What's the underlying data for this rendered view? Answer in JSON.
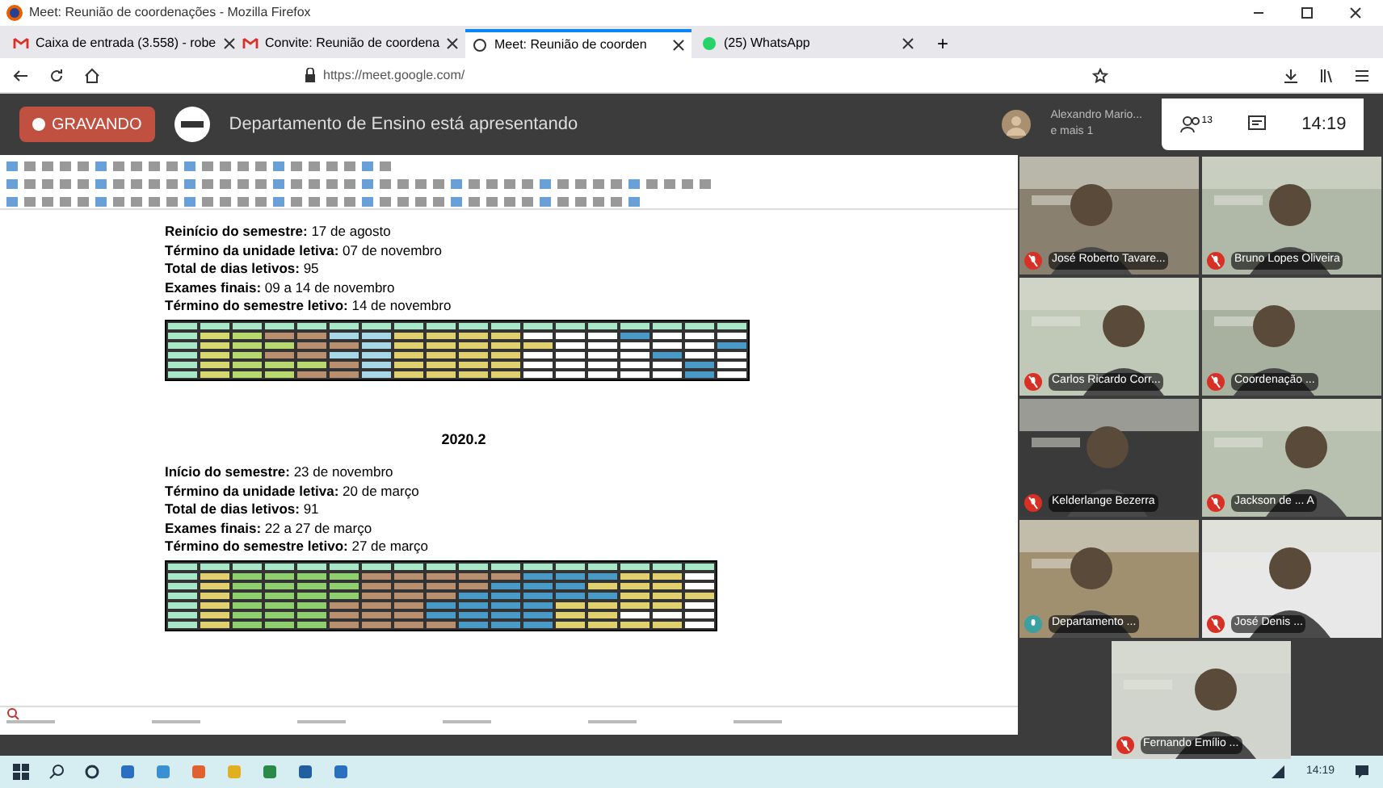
{
  "window": {
    "title": "Meet: Reunião de coordenações - Mozilla Firefox"
  },
  "tabs": [
    {
      "label": "Caixa de entrada (3.558) - robe",
      "kind": "mail",
      "selected": false
    },
    {
      "label": "Convite: Reunião de coordena",
      "kind": "mail",
      "selected": false
    },
    {
      "label": "Meet: Reunião de coorden",
      "kind": "meet",
      "selected": true
    },
    {
      "label": "(25) WhatsApp",
      "kind": "chat",
      "selected": false
    }
  ],
  "new_tab": "+",
  "address_bar": {
    "url": "https://meet.google.com/"
  },
  "meet_bar": {
    "recording": "GRAVANDO",
    "presenter": "Departamento de Ensino está apresentando",
    "viewer": "Alexandro Mario...",
    "viewer_more": "e mais 1",
    "participants_count": "13",
    "clock": "14:19"
  },
  "document": {
    "lines_1": [
      "**Reinício do semestre:** 17 de agosto",
      "**Término da unidade letiva:** 07 de novembro",
      "**Total de dias letivos:** 95",
      "**Exames finais:** 09 a 14 de novembro",
      "**Término do semestre letivo:** 14 de novembro"
    ],
    "table_1": [
      {
        "cells": [
          {
            "color": "#a8e8c8"
          },
          {
            "color": "#a8e8c8"
          },
          {
            "color": "#a8e8c8"
          },
          {
            "color": "#a8e8c8"
          },
          {
            "color": "#a8e8c8"
          },
          {
            "color": "#a8e8c8"
          },
          {
            "color": "#a8e8c8"
          },
          {
            "color": "#a8e8c8"
          },
          {
            "color": "#a8e8c8"
          },
          {
            "color": "#a8e8c8"
          },
          {
            "color": "#a8e8c8"
          },
          {
            "color": "#a8e8c8"
          },
          {
            "color": "#a8e8c8"
          },
          {
            "color": "#a8e8c8"
          },
          {
            "color": "#a8e8c8"
          },
          {
            "color": "#a8e8c8"
          },
          {
            "color": "#a8e8c8"
          },
          {
            "color": "#a8e8c8"
          }
        ]
      },
      {
        "cells": [
          {
            "color": "#a8e8c8"
          },
          {
            "color": "#d8d870"
          },
          {
            "color": "#b8d870"
          },
          {
            "color": "#b89070"
          },
          {
            "color": "#b89070"
          },
          {
            "color": "#a8d8e8"
          },
          {
            "color": "#a8d8e8"
          },
          {
            "color": "#e0d070"
          },
          {
            "color": "#e0d070"
          },
          {
            "color": "#e0d070"
          },
          {
            "color": "#e0d070"
          },
          {
            "color": "#ffffff"
          },
          {
            "color": "#ffffff"
          },
          {
            "color": "#ffffff"
          },
          {
            "color": "#4a9ac8"
          },
          {
            "color": "#ffffff"
          },
          {
            "color": "#ffffff"
          },
          {
            "color": "#ffffff"
          }
        ]
      },
      {
        "cells": [
          {
            "color": "#a8e8c8"
          },
          {
            "color": "#d8d870"
          },
          {
            "color": "#b8d870"
          },
          {
            "color": "#b8d870"
          },
          {
            "color": "#b89070"
          },
          {
            "color": "#b89070"
          },
          {
            "color": "#a8d8e8"
          },
          {
            "color": "#e0d070"
          },
          {
            "color": "#e0d070"
          },
          {
            "color": "#e0d070"
          },
          {
            "color": "#e0d070"
          },
          {
            "color": "#e0d070"
          },
          {
            "color": "#ffffff"
          },
          {
            "color": "#ffffff"
          },
          {
            "color": "#ffffff"
          },
          {
            "color": "#ffffff"
          },
          {
            "color": "#ffffff"
          },
          {
            "color": "#4a9ac8"
          }
        ]
      },
      {
        "cells": [
          {
            "color": "#a8e8c8"
          },
          {
            "color": "#d8d870"
          },
          {
            "color": "#b8d870"
          },
          {
            "color": "#b89070"
          },
          {
            "color": "#b89070"
          },
          {
            "color": "#a8d8e8"
          },
          {
            "color": "#a8d8e8"
          },
          {
            "color": "#e0d070"
          },
          {
            "color": "#e0d070"
          },
          {
            "color": "#e0d070"
          },
          {
            "color": "#e0d070"
          },
          {
            "color": "#ffffff"
          },
          {
            "color": "#ffffff"
          },
          {
            "color": "#ffffff"
          },
          {
            "color": "#ffffff"
          },
          {
            "color": "#4a9ac8"
          },
          {
            "color": "#ffffff"
          },
          {
            "color": "#ffffff"
          }
        ]
      },
      {
        "cells": [
          {
            "color": "#a8e8c8"
          },
          {
            "color": "#d8d870"
          },
          {
            "color": "#b8d870"
          },
          {
            "color": "#b8d870"
          },
          {
            "color": "#b8d870"
          },
          {
            "color": "#b89070"
          },
          {
            "color": "#a8d8e8"
          },
          {
            "color": "#e0d070"
          },
          {
            "color": "#e0d070"
          },
          {
            "color": "#e0d070"
          },
          {
            "color": "#e0d070"
          },
          {
            "color": "#ffffff"
          },
          {
            "color": "#ffffff"
          },
          {
            "color": "#ffffff"
          },
          {
            "color": "#ffffff"
          },
          {
            "color": "#ffffff"
          },
          {
            "color": "#4a9ac8"
          },
          {
            "color": "#ffffff"
          }
        ]
      },
      {
        "cells": [
          {
            "color": "#a8e8c8"
          },
          {
            "color": "#d8d870"
          },
          {
            "color": "#b8d870"
          },
          {
            "color": "#b8d870"
          },
          {
            "color": "#b89070"
          },
          {
            "color": "#b89070"
          },
          {
            "color": "#a8d8e8"
          },
          {
            "color": "#e0d070"
          },
          {
            "color": "#e0d070"
          },
          {
            "color": "#e0d070"
          },
          {
            "color": "#e0d070"
          },
          {
            "color": "#ffffff"
          },
          {
            "color": "#ffffff"
          },
          {
            "color": "#ffffff"
          },
          {
            "color": "#ffffff"
          },
          {
            "color": "#ffffff"
          },
          {
            "color": "#4a9ac8"
          },
          {
            "color": "#ffffff"
          }
        ]
      }
    ],
    "heading_2": "2020.2",
    "lines_2": [
      "**Início do semestre:** 23 de novembro",
      "**Término da unidade letiva:** 20 de março",
      "**Total de dias letivos:** 91",
      "**Exames finais:** 22 a 27 de março",
      "**Término do semestre letivo:** 27 de março"
    ],
    "table_2": [
      {
        "cells": [
          {
            "color": "#a8e8c8"
          },
          {
            "color": "#a8e8c8"
          },
          {
            "color": "#a8e8c8"
          },
          {
            "color": "#a8e8c8"
          },
          {
            "color": "#a8e8c8"
          },
          {
            "color": "#a8e8c8"
          },
          {
            "color": "#a8e8c8"
          },
          {
            "color": "#a8e8c8"
          },
          {
            "color": "#a8e8c8"
          },
          {
            "color": "#a8e8c8"
          },
          {
            "color": "#a8e8c8"
          },
          {
            "color": "#a8e8c8"
          },
          {
            "color": "#a8e8c8"
          },
          {
            "color": "#a8e8c8"
          },
          {
            "color": "#a8e8c8"
          },
          {
            "color": "#a8e8c8"
          },
          {
            "color": "#a8e8c8"
          }
        ]
      },
      {
        "cells": [
          {
            "color": "#a8e8c8"
          },
          {
            "color": "#e0d070"
          },
          {
            "color": "#8fcf70"
          },
          {
            "color": "#8fcf70"
          },
          {
            "color": "#8fcf70"
          },
          {
            "color": "#8fcf70"
          },
          {
            "color": "#b89070"
          },
          {
            "color": "#b89070"
          },
          {
            "color": "#b89070"
          },
          {
            "color": "#b89070"
          },
          {
            "color": "#b89070"
          },
          {
            "color": "#4a9ac8"
          },
          {
            "color": "#4a9ac8"
          },
          {
            "color": "#4a9ac8"
          },
          {
            "color": "#e0d070"
          },
          {
            "color": "#e0d070"
          },
          {
            "color": "#ffffff"
          }
        ]
      },
      {
        "cells": [
          {
            "color": "#a8e8c8"
          },
          {
            "color": "#e0d070"
          },
          {
            "color": "#8fcf70"
          },
          {
            "color": "#8fcf70"
          },
          {
            "color": "#8fcf70"
          },
          {
            "color": "#8fcf70"
          },
          {
            "color": "#b89070"
          },
          {
            "color": "#b89070"
          },
          {
            "color": "#b89070"
          },
          {
            "color": "#b89070"
          },
          {
            "color": "#4a9ac8"
          },
          {
            "color": "#4a9ac8"
          },
          {
            "color": "#4a9ac8"
          },
          {
            "color": "#e0d070"
          },
          {
            "color": "#e0d070"
          },
          {
            "color": "#e0d070"
          },
          {
            "color": "#ffffff"
          }
        ]
      },
      {
        "cells": [
          {
            "color": "#a8e8c8"
          },
          {
            "color": "#e0d070"
          },
          {
            "color": "#8fcf70"
          },
          {
            "color": "#8fcf70"
          },
          {
            "color": "#8fcf70"
          },
          {
            "color": "#8fcf70"
          },
          {
            "color": "#b89070"
          },
          {
            "color": "#b89070"
          },
          {
            "color": "#b89070"
          },
          {
            "color": "#4a9ac8"
          },
          {
            "color": "#4a9ac8"
          },
          {
            "color": "#4a9ac8"
          },
          {
            "color": "#4a9ac8"
          },
          {
            "color": "#4a9ac8"
          },
          {
            "color": "#e0d070"
          },
          {
            "color": "#e0d070"
          },
          {
            "color": "#e0d070"
          }
        ]
      },
      {
        "cells": [
          {
            "color": "#a8e8c8"
          },
          {
            "color": "#e0d070"
          },
          {
            "color": "#8fcf70"
          },
          {
            "color": "#8fcf70"
          },
          {
            "color": "#8fcf70"
          },
          {
            "color": "#b89070"
          },
          {
            "color": "#b89070"
          },
          {
            "color": "#b89070"
          },
          {
            "color": "#4a9ac8"
          },
          {
            "color": "#4a9ac8"
          },
          {
            "color": "#4a9ac8"
          },
          {
            "color": "#4a9ac8"
          },
          {
            "color": "#e0d070"
          },
          {
            "color": "#e0d070"
          },
          {
            "color": "#e0d070"
          },
          {
            "color": "#e0d070"
          },
          {
            "color": "#ffffff"
          }
        ]
      },
      {
        "cells": [
          {
            "color": "#a8e8c8"
          },
          {
            "color": "#e0d070"
          },
          {
            "color": "#8fcf70"
          },
          {
            "color": "#8fcf70"
          },
          {
            "color": "#8fcf70"
          },
          {
            "color": "#b89070"
          },
          {
            "color": "#b89070"
          },
          {
            "color": "#b89070"
          },
          {
            "color": "#4a9ac8"
          },
          {
            "color": "#4a9ac8"
          },
          {
            "color": "#4a9ac8"
          },
          {
            "color": "#4a9ac8"
          },
          {
            "color": "#e0d070"
          },
          {
            "color": "#e0d070"
          },
          {
            "color": "#ffffff"
          },
          {
            "color": "#ffffff"
          },
          {
            "color": "#ffffff"
          }
        ]
      },
      {
        "cells": [
          {
            "color": "#a8e8c8"
          },
          {
            "color": "#e0d070"
          },
          {
            "color": "#8fcf70"
          },
          {
            "color": "#8fcf70"
          },
          {
            "color": "#8fcf70"
          },
          {
            "color": "#b89070"
          },
          {
            "color": "#b89070"
          },
          {
            "color": "#b89070"
          },
          {
            "color": "#b89070"
          },
          {
            "color": "#4a9ac8"
          },
          {
            "color": "#4a9ac8"
          },
          {
            "color": "#4a9ac8"
          },
          {
            "color": "#e0d070"
          },
          {
            "color": "#e0d070"
          },
          {
            "color": "#e0d070"
          },
          {
            "color": "#e0d070"
          },
          {
            "color": "#ffffff"
          }
        ]
      }
    ]
  },
  "participants": [
    {
      "name": "José Roberto Tavare...",
      "muted": true
    },
    {
      "name": "Bruno Lopes Oliveira",
      "muted": true
    },
    {
      "name": "Carlos Ricardo Corr...",
      "muted": true
    },
    {
      "name": "Coordenação ...",
      "muted": true
    },
    {
      "name": "Kelderlange Bezerra",
      "muted": true
    },
    {
      "name": "Jackson de ... A",
      "muted": true
    },
    {
      "name": "Departamento ...",
      "muted": false
    },
    {
      "name": "José Denis ...",
      "muted": true
    },
    {
      "name": "Fernando Emílio ...",
      "muted": true
    }
  ],
  "taskbar": {
    "clock": "14:19"
  }
}
